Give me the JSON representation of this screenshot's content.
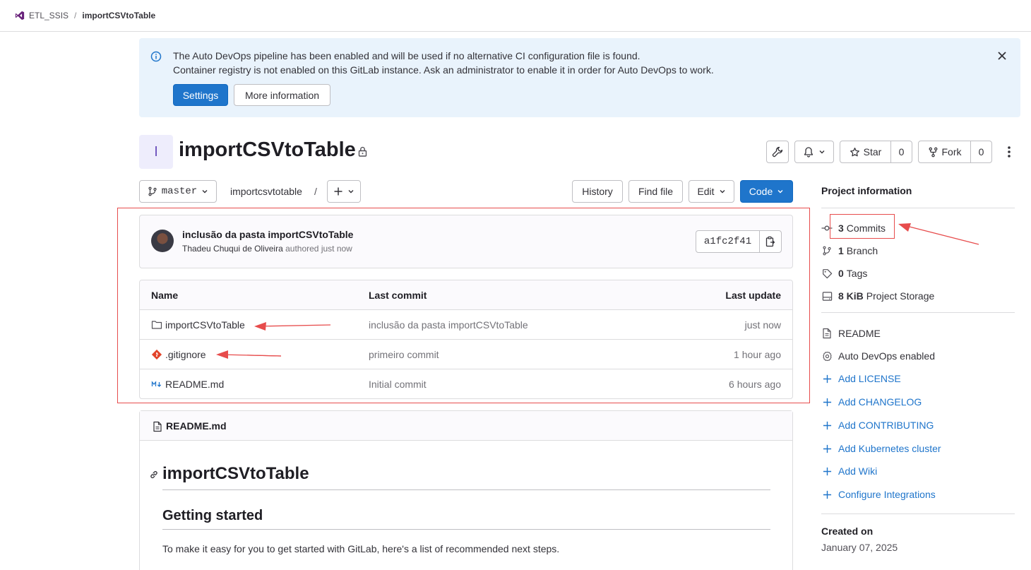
{
  "breadcrumb": {
    "group": "ETL_SSIS",
    "separator": "/",
    "project": "importCSVtoTable"
  },
  "alert": {
    "line1": "The Auto DevOps pipeline has been enabled and will be used if no alternative CI configuration file is found.",
    "line2": "Container registry is not enabled on this GitLab instance. Ask an administrator to enable it in order for Auto DevOps to work.",
    "settings_label": "Settings",
    "more_label": "More information",
    "accent": "#1f75cb",
    "background": "#e9f3fc"
  },
  "project": {
    "avatar_letter": "I",
    "title": "importCSVtoTable",
    "star_label": "Star",
    "star_count": "0",
    "fork_label": "Fork",
    "fork_count": "0"
  },
  "toolbar": {
    "branch": "master",
    "path": "importcsvtotable",
    "path_sep": "/",
    "history_label": "History",
    "findfile_label": "Find file",
    "edit_label": "Edit",
    "code_label": "Code"
  },
  "last_commit": {
    "message": "inclusão da pasta importCSVtoTable",
    "author": "Thadeu Chuqui de Oliveira",
    "authored": "authored just now",
    "sha": "a1fc2f41"
  },
  "files": {
    "headers": {
      "name": "Name",
      "last_commit": "Last commit",
      "last_update": "Last update"
    },
    "rows": [
      {
        "name": "importCSVtoTable",
        "icon": "folder-icon",
        "commit": "inclusão da pasta importCSVtoTable",
        "updated": "just now"
      },
      {
        "name": ".gitignore",
        "icon": "git-icon",
        "commit": "primeiro commit",
        "updated": "1 hour ago"
      },
      {
        "name": "README.md",
        "icon": "markdown-icon",
        "commit": "Initial commit",
        "updated": "6 hours ago"
      }
    ]
  },
  "readme": {
    "filename": "README.md",
    "h1": "importCSVtoTable",
    "h2": "Getting started",
    "p": "To make it easy for you to get started with GitLab, here's a list of recommended next steps."
  },
  "sidebar": {
    "title": "Project information",
    "commits_count": "3",
    "commits_label": "Commits",
    "branch_count": "1",
    "branch_label": "Branch",
    "tags_count": "0",
    "tags_label": "Tags",
    "storage_value": "8 KiB",
    "storage_label": "Project Storage",
    "readme_label": "README",
    "autodevops_label": "Auto DevOps enabled",
    "links": [
      "Add LICENSE",
      "Add CHANGELOG",
      "Add CONTRIBUTING",
      "Add Kubernetes cluster",
      "Add Wiki",
      "Configure Integrations"
    ],
    "created_label": "Created on",
    "created_value": "January 07, 2025"
  },
  "annotation_color": "#e74c4c"
}
